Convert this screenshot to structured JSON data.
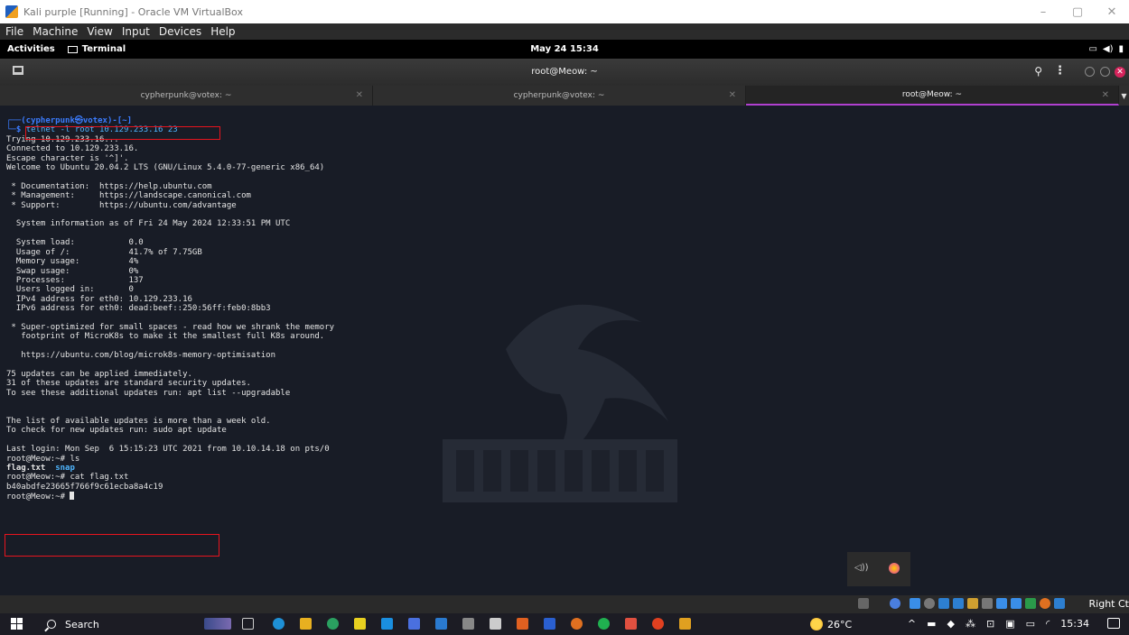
{
  "vbox": {
    "title": "Kali purple [Running] - Oracle VM VirtualBox",
    "menu": [
      "File",
      "Machine",
      "View",
      "Input",
      "Devices",
      "Help"
    ],
    "min": "–",
    "restore": "▢",
    "close": "✕",
    "right_ctrl": "Right Ct"
  },
  "gnome": {
    "activities": "Activities",
    "app": "Terminal",
    "clock": "May 24  15:34",
    "tray": [
      "▭",
      "◀)",
      "▮"
    ]
  },
  "terminal": {
    "title": "root@Meow: ~",
    "tabs": [
      {
        "label": "cypherpunk@votex: ~",
        "close": "✕"
      },
      {
        "label": "cypherpunk@votex: ~",
        "close": "✕"
      },
      {
        "label": "root@Meow: ~",
        "close": "✕"
      }
    ],
    "tab_arrow": "▼",
    "prompt_line1": "┌──(cypherpunk㉿votex)-[~]",
    "prompt_prefix": "└─$ ",
    "command": "telnet -l root 10.129.233.16 23",
    "output_a": "Trying 10.129.233.16...\nConnected to 10.129.233.16.\nEscape character is '^]'.\nWelcome to Ubuntu 20.04.2 LTS (GNU/Linux 5.4.0-77-generic x86_64)\n\n * Documentation:  https://help.ubuntu.com\n * Management:     https://landscape.canonical.com\n * Support:        https://ubuntu.com/advantage\n\n  System information as of Fri 24 May 2024 12:33:51 PM UTC\n\n  System load:           0.0\n  Usage of /:            41.7% of 7.75GB\n  Memory usage:          4%\n  Swap usage:            0%\n  Processes:             137\n  Users logged in:       0\n  IPv4 address for eth0: 10.129.233.16\n  IPv6 address for eth0: dead:beef::250:56ff:feb0:8bb3\n\n * Super-optimized for small spaces - read how we shrank the memory\n   footprint of MicroK8s to make it the smallest full K8s around.\n\n   https://ubuntu.com/blog/microk8s-memory-optimisation\n\n75 updates can be applied immediately.\n31 of these updates are standard security updates.\nTo see these additional updates run: apt list --upgradable\n\n\nThe list of available updates is more than a week old.\nTo check for new updates run: sudo apt update\n\nLast login: Mon Sep  6 15:15:23 UTC 2021 from 10.10.14.18 on pts/0\nroot@Meow:~# ls",
    "ls_file": "flag.txt",
    "ls_dir": "snap",
    "cat_cmd": "root@Meow:~# cat flag.txt",
    "flag": "b40abdfe23665f766f9c61ecba8a4c19",
    "final_prompt": "root@Meow:~# ",
    "tray_popup_icon": "◁))"
  },
  "taskbar": {
    "search": "Search",
    "temperature": "26°C",
    "tray": [
      "^",
      "▬",
      "◆",
      "⁂",
      "⊡",
      "▣",
      "▭",
      "◜"
    ],
    "time": "15:34"
  }
}
